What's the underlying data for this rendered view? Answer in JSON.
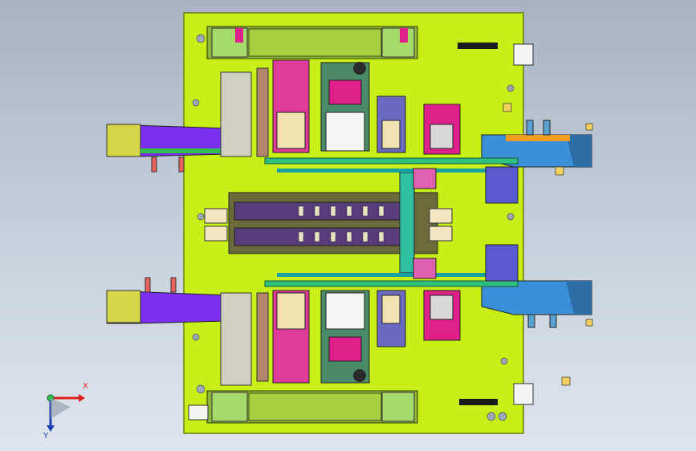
{
  "viewport": {
    "background_top": "#a7b3c2",
    "background_bottom": "#dfe5ec",
    "model_plate_color": "#c8f018",
    "accent_colors": [
      "#7a2ff0",
      "#3a8fd6",
      "#e0208a",
      "#2fbf4f",
      "#f0a020",
      "#2b2b2b",
      "#e5e5e5"
    ]
  },
  "triad": {
    "x_label": "X",
    "y_label": "Y",
    "icons": [
      "axis-x-arrow-icon",
      "axis-y-arrow-icon",
      "axis-origin-icon"
    ]
  }
}
